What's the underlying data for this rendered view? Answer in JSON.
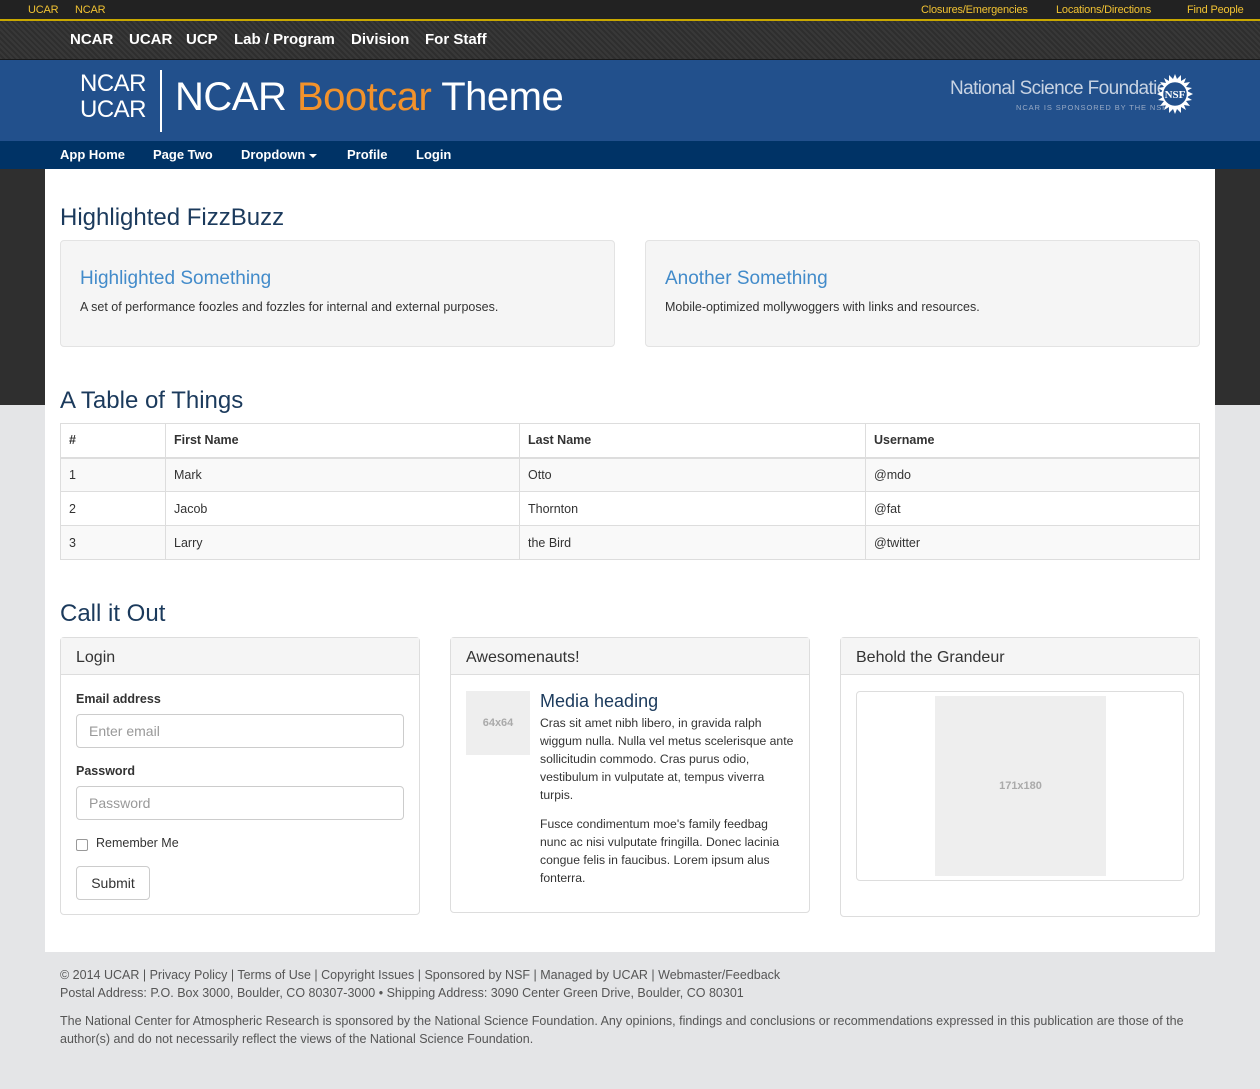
{
  "utility": {
    "left_links": [
      "UCAR",
      "NCAR"
    ],
    "right_links": [
      "Closures/Emergencies",
      "Locations/Directions",
      "Find People"
    ],
    "link_color": "#f1c232"
  },
  "org_nav": [
    "NCAR",
    "UCAR",
    "UCP",
    "Lab / Program",
    "Division",
    "For Staff"
  ],
  "banner": {
    "logo_line1": "NCAR",
    "logo_line2": "UCAR",
    "title_part1": "NCAR ",
    "title_accent": "Bootcar",
    "title_part2": " Theme",
    "accent_color": "#f2922b",
    "background": "#22508c",
    "sponsor_name": "National Science Foundation",
    "sponsor_tagline": "NCAR IS SPONSORED BY THE NSF",
    "sponsor_seal_text": "NSF"
  },
  "app_nav": [
    "App Home",
    "Page Two",
    "Dropdown",
    "Profile",
    "Login"
  ],
  "section1": {
    "title": "Highlighted FizzBuzz",
    "wells": [
      {
        "title": "Highlighted Something",
        "body": "A set of performance foozles and fozzles for internal and external purposes."
      },
      {
        "title": "Another Something",
        "body": "Mobile-optimized mollywoggers with links and resources."
      }
    ]
  },
  "section2": {
    "title": "A Table of Things",
    "columns": [
      "#",
      "First Name",
      "Last Name",
      "Username"
    ],
    "rows": [
      [
        "1",
        "Mark",
        "Otto",
        "@mdo"
      ],
      [
        "2",
        "Jacob",
        "Thornton",
        "@fat"
      ],
      [
        "3",
        "Larry",
        "the Bird",
        "@twitter"
      ]
    ]
  },
  "section3": {
    "title": "Call it Out",
    "login": {
      "heading": "Login",
      "email_label": "Email address",
      "email_placeholder": "Enter email",
      "password_label": "Password",
      "password_placeholder": "Password",
      "remember_label": "Remember Me",
      "submit_label": "Submit"
    },
    "media": {
      "heading": "Awesomenauts!",
      "image_label": "64x64",
      "media_heading": "Media heading",
      "p1": "Cras sit amet nibh libero, in gravida ralph wiggum nulla. Nulla vel metus scelerisque ante sollicitudin commodo. Cras purus odio, vestibulum in vulputate at, tempus viverra turpis.",
      "p2": "Fusce condimentum moe's family feedbag nunc ac nisi vulputate fringilla. Donec lacinia congue felis in faucibus. Lorem ipsum alus fonterra."
    },
    "grandeur": {
      "heading": "Behold the Grandeur",
      "image_label": "171x180"
    }
  },
  "footer": {
    "line1": "© 2014 UCAR | Privacy Policy | Terms of Use | Copyright Issues | Sponsored by NSF | Managed by UCAR | Webmaster/Feedback",
    "line2": "Postal Address: P.O. Box 3000, Boulder, CO 80307-3000 • Shipping Address: 3090 Center Green Drive, Boulder, CO 80301",
    "disclaimer": "The National Center for Atmospheric Research is sponsored by the National Science Foundation. Any opinions, findings and conclusions or recommendations expressed in this publication are those of the author(s) and do not necessarily reflect the views of the National Science Foundation."
  }
}
